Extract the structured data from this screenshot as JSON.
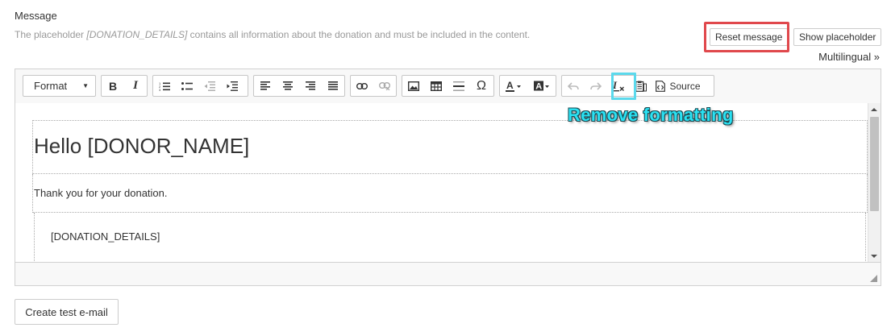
{
  "field": {
    "label": "Message",
    "hint_before": "The placeholder ",
    "hint_placeholder": "[DONATION_DETAILS]",
    "hint_after": " contains all information about the donation and must be included in the content."
  },
  "actions": {
    "reset_label": "Reset message",
    "show_placeholder_label": "Show placeholder",
    "multilingual_label": "Multilingual »"
  },
  "toolbar": {
    "format_label": "Format",
    "bold_label": "B",
    "italic_label": "I",
    "source_label": "Source",
    "special_char_label": "Ω"
  },
  "annotation": {
    "text": "Remove formatting",
    "highlight_color": "#5bd9ec",
    "reset_highlight_color": "#e0484c"
  },
  "content": {
    "heading": "Hello [DONOR_NAME]",
    "paragraph": "Thank you for your donation.",
    "details": "[DONATION_DETAILS]"
  },
  "footer": {
    "create_test_label": "Create test e-mail"
  }
}
